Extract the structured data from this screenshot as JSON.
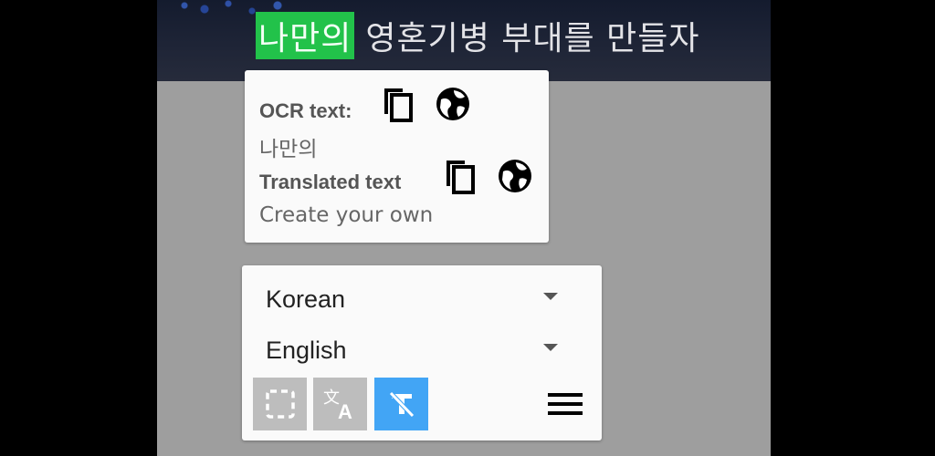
{
  "banner": {
    "highlight": "나만의",
    "rest": "영혼기병 부대를 만들자"
  },
  "ocr_card": {
    "ocr_label": "OCR text:",
    "ocr_value": "나만의",
    "translated_label": "Translated text",
    "translated_value": "Create your own",
    "icons": [
      "copy-icon",
      "globe-icon"
    ]
  },
  "language_panel": {
    "source_language": "Korean",
    "target_language": "English",
    "tools": [
      "select-area-icon",
      "translate-icon",
      "clear-translation-icon",
      "menu-icon"
    ]
  },
  "colors": {
    "highlight": "#22c24a",
    "active_tool": "#42a5f5",
    "inactive_tool": "#bdbdbd",
    "background": "#9e9e9e"
  }
}
